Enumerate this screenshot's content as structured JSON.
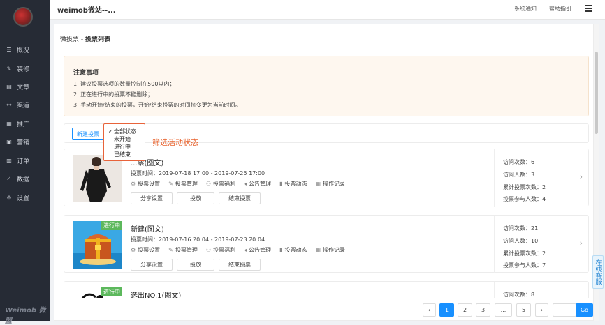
{
  "topbar": {
    "site_title": "weimob微站--...",
    "system_notice": "系统通知",
    "help": "帮助指引"
  },
  "sidebar": {
    "items": [
      {
        "label": "概况",
        "icon": "overview-icon"
      },
      {
        "label": "装修",
        "icon": "decorate-icon"
      },
      {
        "label": "文章",
        "icon": "article-icon"
      },
      {
        "label": "渠道",
        "icon": "channel-icon"
      },
      {
        "label": "推广",
        "icon": "promote-icon"
      },
      {
        "label": "营销",
        "icon": "marketing-icon"
      },
      {
        "label": "订单",
        "icon": "order-icon"
      },
      {
        "label": "数据",
        "icon": "data-icon"
      },
      {
        "label": "设置",
        "icon": "settings-icon"
      }
    ],
    "brand": "Weimob 微盟"
  },
  "page": {
    "title_prefix": "微投票 - ",
    "title_main": "投票列表"
  },
  "notice": {
    "heading": "注意事项",
    "lines": [
      "1. 建议投票选项的数量控制在500以内；",
      "2. 正在进行中的投票不能删除；",
      "3. 手动开始/结束的投票，开始/结束投票的时间将变更为当前时间。"
    ]
  },
  "filter": {
    "new_button": "新建投票",
    "options": [
      "全部状态",
      "未开始",
      "进行中",
      "已结束"
    ],
    "selected": "全部状态"
  },
  "annotation": "筛选活动状态",
  "ops_labels": [
    "投票设置",
    "投票管理",
    "投票福利",
    "公告管理",
    "投票动态",
    "操作记录"
  ],
  "btn_labels": [
    "分享设置",
    "投放",
    "结束投票"
  ],
  "stat_labels": {
    "visits": "访问次数：",
    "visitors": "访问人数：",
    "votes": "累计投票次数：",
    "participants": "投票参与人数："
  },
  "cards": [
    {
      "title": "...票(图文)",
      "time": "投票时间：2019-07-18 17:00 - 2019-07-25 17:00",
      "badge": "",
      "visits": "6",
      "visitors": "3",
      "votes": "2",
      "participants": "4"
    },
    {
      "title": "新建(图文)",
      "time": "投票时间：2019-07-16 20:04 - 2019-07-23 20:04",
      "badge": "进行中",
      "visits": "21",
      "visitors": "10",
      "votes": "2",
      "participants": "7"
    },
    {
      "title": "选出NO.1(图文)",
      "badge": "进行中",
      "visits": "8"
    }
  ],
  "pager": {
    "prev": "‹",
    "pages": [
      "1",
      "2",
      "3",
      "...",
      "5"
    ],
    "next": "›",
    "go": "Go"
  },
  "online_service": "在线客服"
}
